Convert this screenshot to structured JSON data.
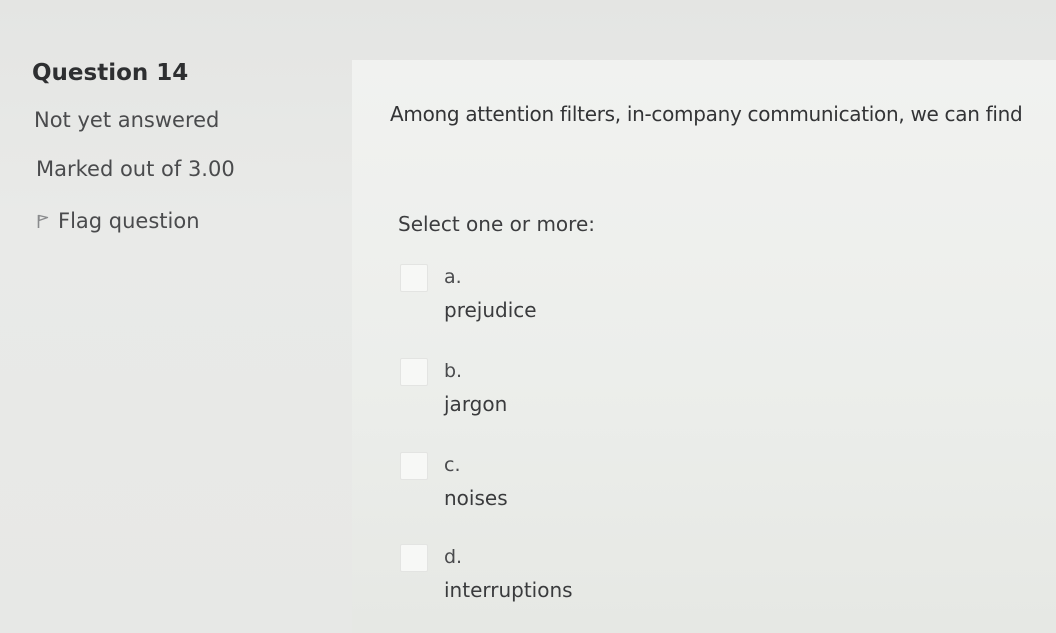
{
  "question_info": {
    "title": "Question 14",
    "state": "Not yet answered",
    "grade": "Marked out of 3.00",
    "flag_label": "Flag question",
    "flag_icon": "flag-icon"
  },
  "question": {
    "text": "Among attention filters, in-company communication, we can find",
    "prompt": "Select one or more:",
    "answers": [
      {
        "letter": "a.",
        "text": "prejudice",
        "checked": false
      },
      {
        "letter": "b.",
        "text": "jargon",
        "checked": false
      },
      {
        "letter": "c.",
        "text": "noises",
        "checked": false
      },
      {
        "letter": "d.",
        "text": "interruptions",
        "checked": false
      }
    ]
  }
}
